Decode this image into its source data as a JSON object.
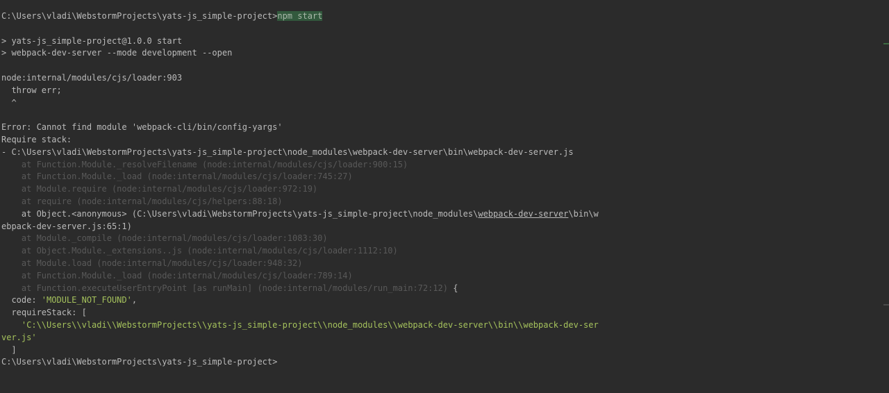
{
  "terminal": {
    "prompt_line": {
      "path": "C:\\Users\\vladi\\WebstormProjects\\yats-js_simple-project>",
      "command": "npm start"
    },
    "script_header": "> yats-js_simple-project@1.0.0 start",
    "script_command": "> webpack-dev-server --mode development --open",
    "loader_location": "node:internal/modules/cjs/loader:903",
    "throw_line": "  throw err;",
    "caret_line": "  ^",
    "error_message": "Error: Cannot find module 'webpack-cli/bin/config-yargs'",
    "require_stack_label": "Require stack:",
    "require_stack_item": "- C:\\Users\\vladi\\WebstormProjects\\yats-js_simple-project\\node_modules\\webpack-dev-server\\bin\\webpack-dev-server.js",
    "stack_frames_a": [
      "    at Function.Module._resolveFilename (node:internal/modules/cjs/loader:900:15)",
      "    at Function.Module._load (node:internal/modules/cjs/loader:745:27)",
      "    at Module.require (node:internal/modules/cjs/loader:972:19)",
      "    at require (node:internal/modules/cjs/helpers:88:18)"
    ],
    "anon_frame": {
      "prefix": "    at Object.<anonymous> (C:\\Users\\vladi\\WebstormProjects\\yats-js_simple-project\\node_modules\\",
      "link": "webpack-dev-server",
      "suffix": "\\bin\\w",
      "wrap": "ebpack-dev-server.js:65:1)"
    },
    "stack_frames_b": [
      "    at Module._compile (node:internal/modules/cjs/loader:1083:30)",
      "    at Object.Module._extensions..js (node:internal/modules/cjs/loader:1112:10)",
      "    at Module.load (node:internal/modules/cjs/loader:948:32)",
      "    at Function.Module._load (node:internal/modules/cjs/loader:789:14)"
    ],
    "last_frame": {
      "text": "    at Function.executeUserEntryPoint [as runMain] (node:internal/modules/run_main:72:12)",
      "brace": " {"
    },
    "code_line": {
      "key": "  code: ",
      "value": "'MODULE_NOT_FOUND'",
      "comma": ","
    },
    "require_stack_key": "  requireStack: [",
    "require_stack_value": "    'C:\\\\Users\\\\vladi\\\\WebstormProjects\\\\yats-js_simple-project\\\\node_modules\\\\webpack-dev-server\\\\bin\\\\webpack-dev-ser",
    "require_stack_value_wrap": "ver.js'",
    "close_bracket": "  ]",
    "final_prompt": "C:\\Users\\vladi\\WebstormProjects\\yats-js_simple-project>"
  },
  "colors": {
    "background": "#2b2b2b",
    "text": "#bbbbbb",
    "dim_text": "#595959",
    "string": "#a5c25c",
    "command_highlight": "#32593d",
    "scroll_marker_green": "#3d6b42",
    "scroll_marker_grey": "#4a4a4a"
  }
}
